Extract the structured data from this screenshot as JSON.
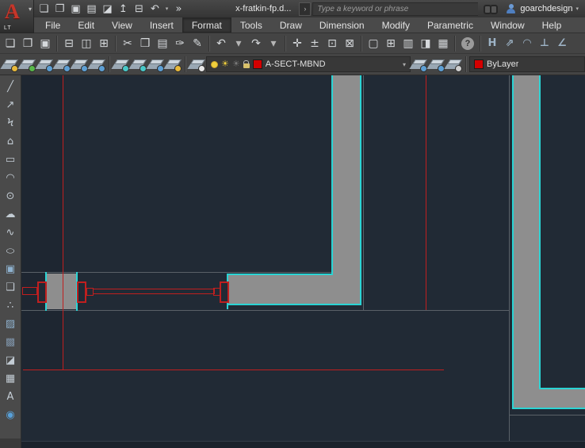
{
  "colors": {
    "titlebar_bg": "#3c3c3c",
    "menubar_bg": "#4a4a4a",
    "toolbar_bg": "#444444",
    "icon_light": "#d6d9dc",
    "icon_steel": "#9db3c6",
    "canvas_bg": "#212a35",
    "canvas_dim": "#1e2631",
    "wall_gray": "#8e8e8e",
    "cad_cyan": "#2bd4d4",
    "cad_red": "#c01f1f",
    "face_gray": "#5a6168",
    "swatch_red": "#d40000",
    "field_bg": "#383838",
    "text_light": "#e2e2e2",
    "placeholder_gray": "#9b9b9b",
    "bottom_strip": "#1b222c"
  },
  "title_bar": {
    "logo_letter": "A",
    "edition": "LT",
    "logo_caret": "▾",
    "quick_access": [
      {
        "name": "qat-new-button",
        "glyph": "❏"
      },
      {
        "name": "qat-open-button",
        "glyph": "❐"
      },
      {
        "name": "qat-save-button",
        "glyph": "▣"
      },
      {
        "name": "qat-save-as-button",
        "glyph": "▤"
      },
      {
        "name": "qat-export-button",
        "glyph": "◪"
      },
      {
        "name": "qat-transfer-button",
        "glyph": "↥"
      },
      {
        "name": "qat-print-button",
        "glyph": "⊟"
      },
      {
        "name": "qat-undo-button",
        "glyph": "↶"
      },
      {
        "name": "qat-undo-caret",
        "glyph": "▾",
        "cls": "caret"
      },
      {
        "name": "qat-overflow-button",
        "glyph": "»"
      }
    ],
    "document_name": "x-fratkin-fp.d...",
    "search_expander": "›",
    "search_placeholder": "Type a keyword or phrase",
    "search_icon": "binoculars",
    "account_icon": "person",
    "username": "goarchdesign",
    "user_caret": "▾"
  },
  "menu_bar": {
    "items": [
      {
        "name": "menu-file",
        "label": "File"
      },
      {
        "name": "menu-edit",
        "label": "Edit"
      },
      {
        "name": "menu-view",
        "label": "View"
      },
      {
        "name": "menu-insert",
        "label": "Insert"
      },
      {
        "name": "menu-format",
        "label": "Format",
        "active": true
      },
      {
        "name": "menu-tools",
        "label": "Tools"
      },
      {
        "name": "menu-draw",
        "label": "Draw"
      },
      {
        "name": "menu-dimension",
        "label": "Dimension"
      },
      {
        "name": "menu-modify",
        "label": "Modify"
      },
      {
        "name": "menu-parametric",
        "label": "Parametric"
      },
      {
        "name": "menu-window",
        "label": "Window"
      },
      {
        "name": "menu-help",
        "label": "Help"
      }
    ]
  },
  "standard_toolbar": {
    "g1": [
      {
        "name": "new-button",
        "glyph": "❏"
      },
      {
        "name": "open-button",
        "glyph": "❐"
      },
      {
        "name": "save-button",
        "glyph": "▣"
      }
    ],
    "g2": [
      {
        "name": "print-button",
        "glyph": "⊟"
      },
      {
        "name": "plot-preview-button",
        "glyph": "◫"
      },
      {
        "name": "publish-button",
        "glyph": "⊞"
      }
    ],
    "g3": [
      {
        "name": "cut-button",
        "glyph": "✂"
      },
      {
        "name": "copy-button",
        "glyph": "❒"
      },
      {
        "name": "paste-button",
        "glyph": "▤"
      },
      {
        "name": "copy-base-button",
        "glyph": "✑"
      },
      {
        "name": "match-properties-button",
        "glyph": "✎"
      }
    ],
    "g4": [
      {
        "name": "undo-button",
        "glyph": "↶"
      },
      {
        "name": "undo-caret",
        "glyph": "▾",
        "cls": "caret"
      },
      {
        "name": "redo-button",
        "glyph": "↷"
      },
      {
        "name": "redo-caret",
        "glyph": "▾",
        "cls": "caret"
      }
    ],
    "g5": [
      {
        "name": "pan-button",
        "glyph": "✛"
      },
      {
        "name": "zoom-realtime-button",
        "glyph": "±"
      },
      {
        "name": "zoom-window-button",
        "glyph": "⊡"
      },
      {
        "name": "zoom-previous-button",
        "glyph": "⊠"
      }
    ],
    "g6": [
      {
        "name": "properties-button",
        "glyph": "▢"
      },
      {
        "name": "design-center-button",
        "glyph": "⊞"
      },
      {
        "name": "tool-palettes-button",
        "glyph": "▥"
      },
      {
        "name": "sheet-set-button",
        "glyph": "◨"
      },
      {
        "name": "calculator-button",
        "glyph": "▦"
      }
    ],
    "help_glyph": "?",
    "dim": [
      {
        "name": "dim-linear-button",
        "glyph": "H"
      },
      {
        "name": "dim-aligned-button",
        "glyph": "⇗"
      },
      {
        "name": "dim-arc-button",
        "glyph": "◠"
      },
      {
        "name": "dim-ordinate-button",
        "glyph": "⊥"
      },
      {
        "name": "dim-angular-button",
        "glyph": "∠"
      }
    ]
  },
  "layers_toolbar": {
    "tools": [
      {
        "name": "make-object-layer-current-button",
        "badge": "#e8b93a"
      },
      {
        "name": "layer-states-button",
        "badge": "#58b84a"
      },
      {
        "name": "layer-match-button",
        "badge": "#5d9fd4"
      },
      {
        "name": "change-to-current-layer-button",
        "badge": "#5d9fd4"
      },
      {
        "name": "layer-update-button",
        "badge": "#5d9fd4"
      },
      {
        "name": "layer-translate-button",
        "badge": "#5d9fd4"
      }
    ],
    "tools2": [
      {
        "name": "layer-freeze-button",
        "badge": "#49c8c8"
      },
      {
        "name": "layer-off-button",
        "badge": "#49c8c8"
      },
      {
        "name": "layer-lock-button",
        "badge": "#5d9fd4"
      },
      {
        "name": "layer-unlock-button",
        "badge": "#e8b93a"
      }
    ],
    "manager": [
      {
        "name": "layer-properties-manager-button",
        "badge": "#e8e8e8"
      }
    ],
    "layer_control": {
      "value": "A-SECT-MBND",
      "swatch": "#d40000",
      "sun_glyph": "☀",
      "chevron": "▾"
    },
    "tools3": [
      {
        "name": "make-current-button",
        "badge": "#5d9fd4"
      },
      {
        "name": "layer-previous-button",
        "badge": "#5d9fd4"
      },
      {
        "name": "layer-states-manager-button",
        "badge": "#cfcfcf"
      }
    ],
    "color_control": {
      "value": "ByLayer",
      "swatch": "#d40000"
    }
  },
  "draw_toolbar": {
    "items": [
      {
        "name": "line-tool",
        "glyph": "╱"
      },
      {
        "name": "construction-line-tool",
        "glyph": "↗"
      },
      {
        "name": "polyline-tool",
        "glyph": "Ϟ"
      },
      {
        "name": "polygon-tool",
        "glyph": "⌂"
      },
      {
        "name": "rectangle-tool",
        "glyph": "▭"
      },
      {
        "name": "arc-tool",
        "glyph": "◠"
      },
      {
        "name": "circle-tool",
        "glyph": "⊙"
      },
      {
        "name": "revision-cloud-tool",
        "glyph": "☁"
      },
      {
        "name": "spline-tool",
        "glyph": "∿"
      },
      {
        "name": "ellipse-tool",
        "glyph": "○",
        "cls": "squash"
      },
      {
        "name": "insert-block-tool",
        "glyph": "▣",
        "tint": "#8fb2cf"
      },
      {
        "name": "make-block-tool",
        "glyph": "❑"
      },
      {
        "name": "point-tool",
        "glyph": "∴"
      },
      {
        "name": "hatch-tool",
        "glyph": "▨",
        "tint": "#8fb2cf"
      },
      {
        "name": "gradient-tool",
        "glyph": "▩",
        "tint": "#7e93a8"
      },
      {
        "name": "region-tool",
        "glyph": "◪"
      },
      {
        "name": "table-tool",
        "glyph": "▦"
      },
      {
        "name": "text-tool",
        "glyph": "A"
      },
      {
        "name": "draw-order-tool",
        "glyph": "◉",
        "tint": "#58a0d8"
      }
    ]
  }
}
